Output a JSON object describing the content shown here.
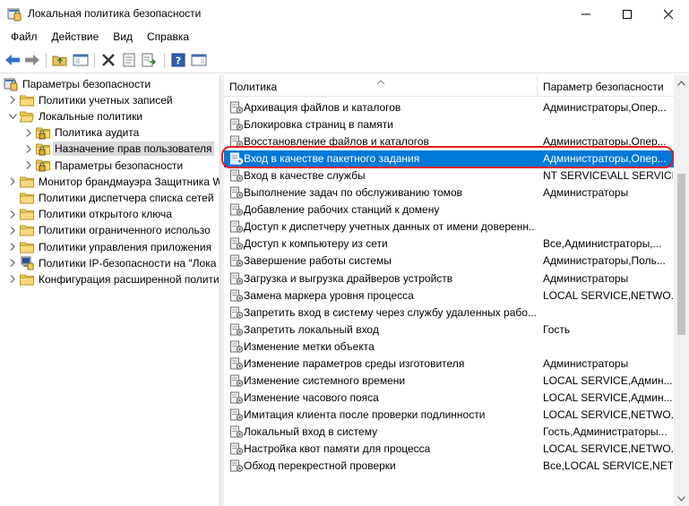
{
  "window": {
    "title": "Локальная политика безопасности"
  },
  "menu": [
    "Файл",
    "Действие",
    "Вид",
    "Справка"
  ],
  "toolbar": {
    "buttons": [
      "back-arrow-icon",
      "forward-arrow-icon",
      "up-folder-icon",
      "show-hide-tree-icon",
      "delete-icon",
      "properties-icon",
      "export-list-icon",
      "help-icon",
      "action-pane-icon"
    ]
  },
  "tree": {
    "items": [
      {
        "label": "Параметры безопасности",
        "level": 0,
        "icon": "security-settings-icon",
        "chevron": "none"
      },
      {
        "label": "Политики учетных записей",
        "level": 1,
        "icon": "folder-icon",
        "chevron": "collapsed"
      },
      {
        "label": "Локальные политики",
        "level": 1,
        "icon": "folder-open-icon",
        "chevron": "expanded"
      },
      {
        "label": "Политика аудита",
        "level": 2,
        "icon": "folder-lock-icon",
        "chevron": "collapsed"
      },
      {
        "label": "Назначение прав пользователя",
        "level": 2,
        "icon": "folder-lock-icon",
        "chevron": "collapsed",
        "selected": true
      },
      {
        "label": "Параметры безопасности",
        "level": 2,
        "icon": "folder-lock-icon",
        "chevron": "collapsed"
      },
      {
        "label": "Монитор брандмауэра Защитника W",
        "level": 1,
        "icon": "folder-icon",
        "chevron": "collapsed"
      },
      {
        "label": "Политики диспетчера списка сетей",
        "level": 1,
        "icon": "folder-icon",
        "chevron": "none"
      },
      {
        "label": "Политики открытого ключа",
        "level": 1,
        "icon": "folder-icon",
        "chevron": "collapsed"
      },
      {
        "label": "Политики ограниченного использо",
        "level": 1,
        "icon": "folder-icon",
        "chevron": "collapsed"
      },
      {
        "label": "Политики управления приложения",
        "level": 1,
        "icon": "folder-icon",
        "chevron": "collapsed"
      },
      {
        "label": "Политики IP-безопасности на \"Лока",
        "level": 1,
        "icon": "ip-security-icon",
        "chevron": "collapsed"
      },
      {
        "label": "Конфигурация расширенной полити",
        "level": 1,
        "icon": "folder-icon",
        "chevron": "collapsed"
      }
    ]
  },
  "list": {
    "columns": [
      "Политика",
      "Параметр безопасности"
    ],
    "selected_index": 3,
    "rows": [
      {
        "name": "Архивация файлов и каталогов",
        "value": "Администраторы,Опер..."
      },
      {
        "name": "Блокировка страниц в памяти",
        "value": ""
      },
      {
        "name": "Восстановление файлов и каталогов",
        "value": "Администраторы,Опер..."
      },
      {
        "name": "Вход в качестве пакетного задания",
        "value": "Администраторы,Опер..."
      },
      {
        "name": "Вход в качестве службы",
        "value": "NT SERVICE\\ALL SERVICES"
      },
      {
        "name": "Выполнение задач по обслуживанию томов",
        "value": "Администраторы"
      },
      {
        "name": "Добавление рабочих станций к домену",
        "value": ""
      },
      {
        "name": "Доступ к диспетчеру учетных данных от имени доверенн...",
        "value": ""
      },
      {
        "name": "Доступ к компьютеру из сети",
        "value": "Все,Администраторы,..."
      },
      {
        "name": "Завершение работы системы",
        "value": "Администраторы,Поль..."
      },
      {
        "name": "Загрузка и выгрузка драйверов устройств",
        "value": "Администраторы"
      },
      {
        "name": "Замена маркера уровня процесса",
        "value": "LOCAL SERVICE,NETWO..."
      },
      {
        "name": "Запретить вход в систему через службу удаленных рабо...",
        "value": ""
      },
      {
        "name": "Запретить локальный вход",
        "value": "Гость"
      },
      {
        "name": "Изменение метки объекта",
        "value": ""
      },
      {
        "name": "Изменение параметров среды изготовителя",
        "value": "Администраторы"
      },
      {
        "name": "Изменение системного времени",
        "value": "LOCAL SERVICE,Админ..."
      },
      {
        "name": "Изменение часового пояса",
        "value": "LOCAL SERVICE,Админ..."
      },
      {
        "name": "Имитация клиента после проверки подлинности",
        "value": "LOCAL SERVICE,NETWO..."
      },
      {
        "name": "Локальный вход в систему",
        "value": "Гость,Администраторы..."
      },
      {
        "name": "Настройка квот памяти для процесса",
        "value": "LOCAL SERVICE,NETWO..."
      },
      {
        "name": "Обход перекрестной проверки",
        "value": "Все,LOCAL SERVICE,NET..."
      }
    ]
  }
}
